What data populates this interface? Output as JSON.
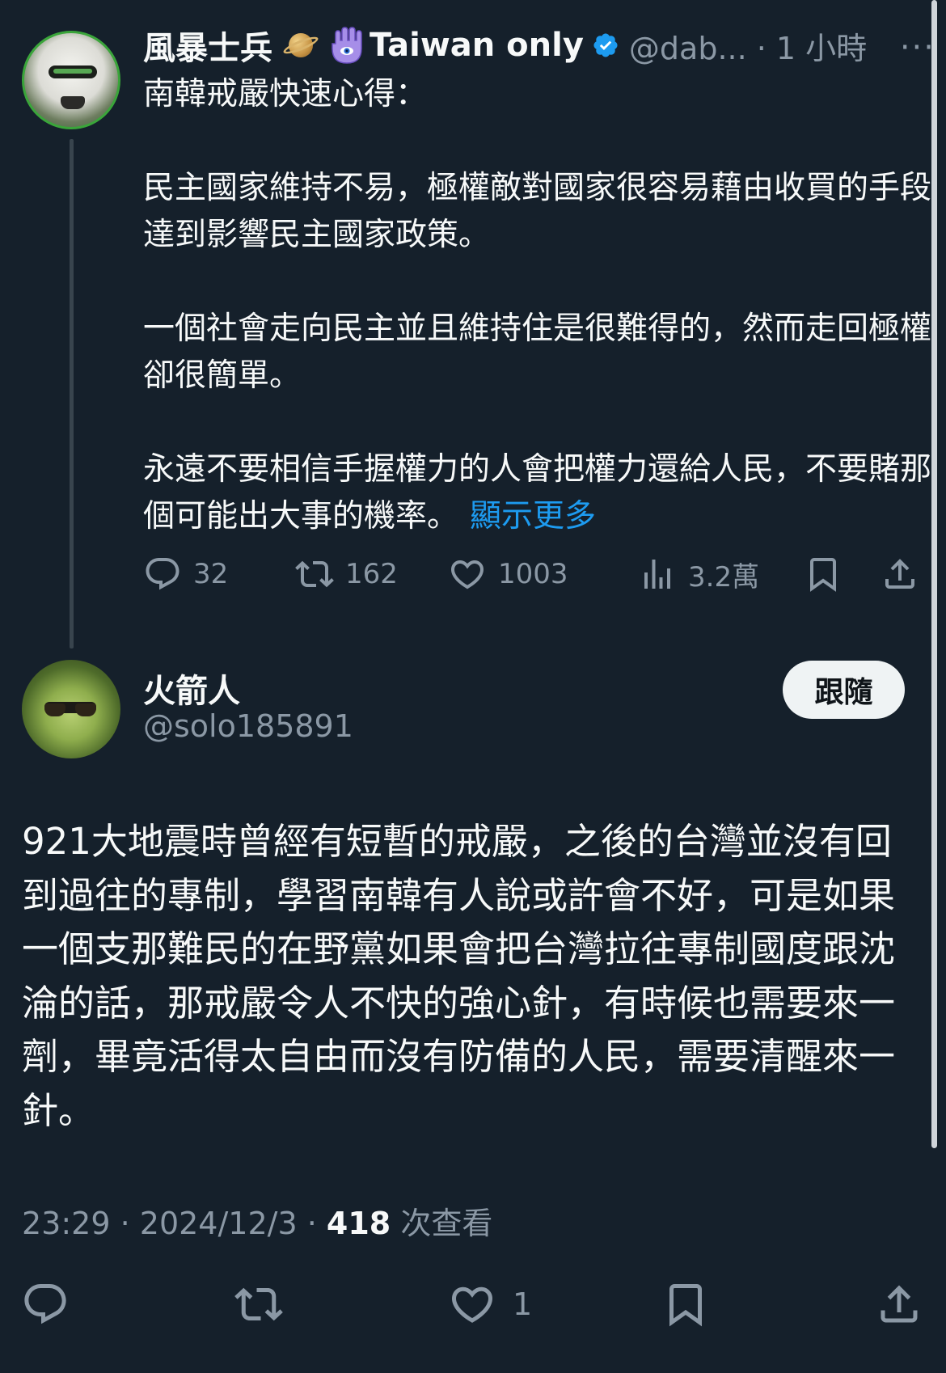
{
  "parent_tweet": {
    "display_name": "風暴士兵",
    "display_name_suffix": "Taiwan only",
    "handle_time": "@dab... · 1 小時",
    "more_label": "···",
    "paragraphs": [
      "南韓戒嚴快速心得：",
      "民主國家維持不易，極權敵對國家很容易藉由收買的手段達到影響民主國家政策。",
      "一個社會走向民主並且維持住是很難得的，然而走回極權卻很簡單。",
      "永遠不要相信手握權力的人會把權力還給人民，不要賭那個可能出大事的機率。"
    ],
    "show_more": "顯示更多",
    "replies": "32",
    "reposts": "162",
    "likes": "1003",
    "views": "3.2萬"
  },
  "reply_tweet": {
    "display_name": "火箭人",
    "handle": "@solo185891",
    "follow_label": "跟隨",
    "body": "921大地震時曾經有短暫的戒嚴，之後的台灣並沒有回到過往的專制，學習南韓有人說或許會不好，可是如果一個支那難民的在野黨如果會把台灣拉往專制國度跟沈淪的話，那戒嚴令人不快的強心針，有時候也需要來一劑，畢竟活得太自由而沒有防備的人民，需要清醒來一針。",
    "time": "23:29",
    "date": "2024/12/3",
    "view_count": "418",
    "view_label": "次查看",
    "likes": "1"
  },
  "colors": {
    "background": "#15202b",
    "text": "#f7f9f9",
    "secondary": "#8b98a5",
    "accent": "#1d9bf0",
    "verified": "#1d9bf0"
  },
  "icons": [
    "verified-badge-icon",
    "reply-icon",
    "repost-icon",
    "like-icon",
    "views-icon",
    "bookmark-icon",
    "share-icon",
    "more-icon"
  ]
}
